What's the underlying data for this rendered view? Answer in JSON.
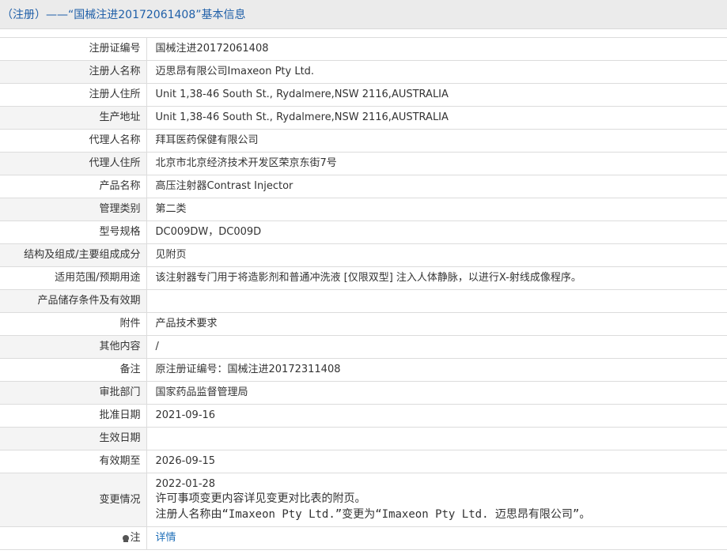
{
  "header": {
    "title": "（注册）——“国械注进20172061408”基本信息"
  },
  "rows": [
    {
      "label": "注册证编号",
      "value": "国械注进20172061408"
    },
    {
      "label": "注册人名称",
      "value": "迈思昂有限公司Imaxeon Pty Ltd."
    },
    {
      "label": "注册人住所",
      "value": "Unit 1,38-46 South St., Rydalmere,NSW 2116,AUSTRALIA"
    },
    {
      "label": "生产地址",
      "value": "Unit 1,38-46 South St., Rydalmere,NSW 2116,AUSTRALIA"
    },
    {
      "label": "代理人名称",
      "value": "拜耳医药保健有限公司"
    },
    {
      "label": "代理人住所",
      "value": "北京市北京经济技术开发区荣京东街7号"
    },
    {
      "label": "产品名称",
      "value": "高压注射器Contrast Injector"
    },
    {
      "label": "管理类别",
      "value": "第二类"
    },
    {
      "label": "型号规格",
      "value": "DC009DW，DC009D"
    },
    {
      "label": "结构及组成/主要组成成分",
      "value": "见附页"
    },
    {
      "label": "适用范围/预期用途",
      "value": "该注射器专门用于将造影剂和普通冲洗液 [仅限双型] 注入人体静脉，以进行X-射线成像程序。"
    },
    {
      "label": "产品储存条件及有效期",
      "value": ""
    },
    {
      "label": "附件",
      "value": "产品技术要求"
    },
    {
      "label": "其他内容",
      "value": "/"
    },
    {
      "label": "备注",
      "value": "原注册证编号：国械注进20172311408"
    },
    {
      "label": "审批部门",
      "value": "国家药品监督管理局"
    },
    {
      "label": "批准日期",
      "value": "2021-09-16"
    },
    {
      "label": "生效日期",
      "value": ""
    },
    {
      "label": "有效期至",
      "value": "2026-09-15"
    }
  ],
  "change": {
    "label": "变更情况",
    "date": "2022-01-28",
    "line1": "许可事项变更内容详见变更对比表的附页。",
    "line2": "注册人名称由“Imaxeon Pty Ltd.”变更为“Imaxeon Pty Ltd. 迈思昂有限公司”。"
  },
  "note": {
    "icon": "pin-icon",
    "label": "注",
    "link_text": "详情"
  }
}
